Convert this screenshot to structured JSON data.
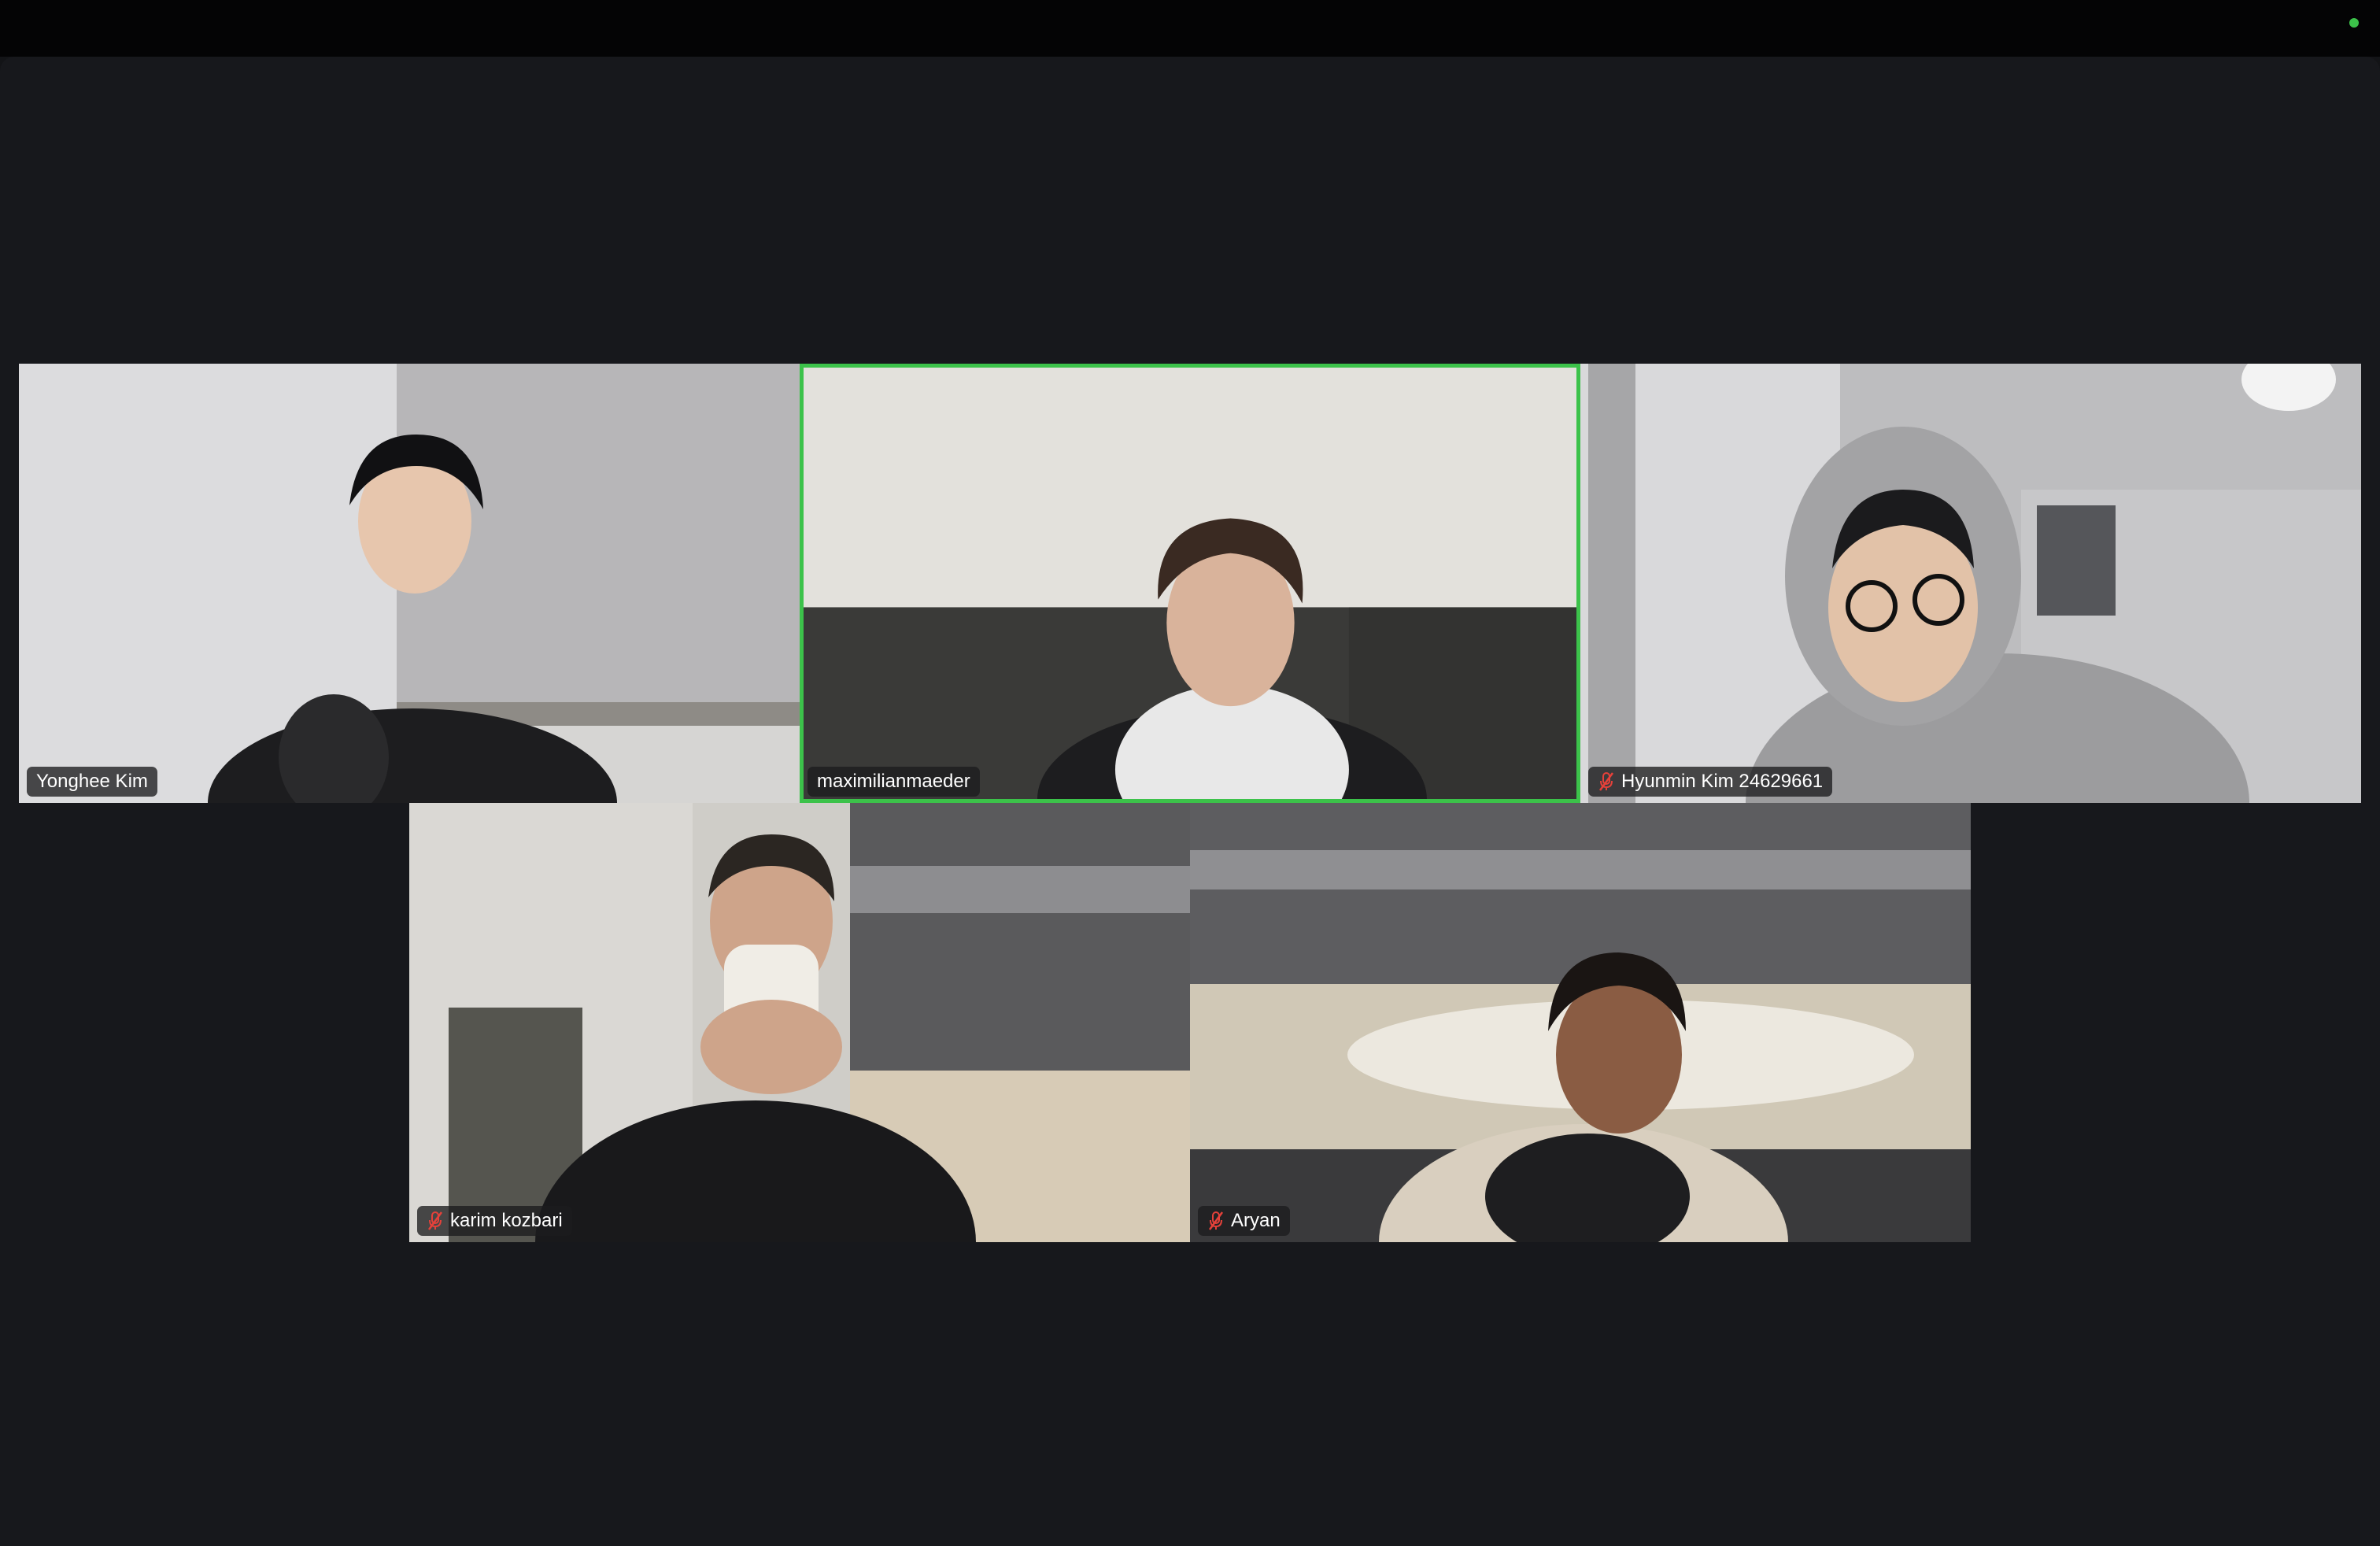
{
  "window": {
    "status_color": "#3cc24a"
  },
  "participants": [
    {
      "name": "Yonghee Kim",
      "muted": false,
      "active_speaker": false
    },
    {
      "name": "maximilianmaeder",
      "muted": false,
      "active_speaker": true
    },
    {
      "name": "Hyunmin Kim 24629661",
      "muted": true,
      "active_speaker": false
    },
    {
      "name": "karim kozbari",
      "muted": true,
      "active_speaker": false
    },
    {
      "name": "Aryan",
      "muted": true,
      "active_speaker": false
    }
  ],
  "colors": {
    "active_border": "#3cc24a",
    "muted_icon": "#e5413a",
    "background": "#17181c"
  }
}
